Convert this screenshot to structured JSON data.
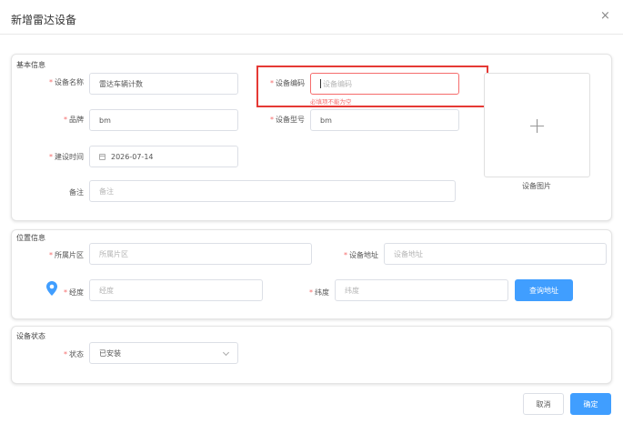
{
  "dialog": {
    "title": "新增雷达设备",
    "close_icon": "×"
  },
  "basic": {
    "title": "基本信息",
    "name_label": "设备名称",
    "name_value": "雷达车辆计数",
    "code_label": "设备编码",
    "code_placeholder": "设备编码",
    "code_error": "必填项不能为空",
    "brand_label": "品牌",
    "brand_value": "bm",
    "model_label": "设备型号",
    "model_value": "bm",
    "date_label": "建设时间",
    "date_value": "2026-07-14",
    "remark_label": "备注",
    "remark_placeholder": "备注",
    "image_label": "设备图片",
    "plus": "+"
  },
  "location": {
    "title": "位置信息",
    "area_label": "所属片区",
    "area_placeholder": "所属片区",
    "address_label": "设备地址",
    "address_placeholder": "设备地址",
    "lng_label": "经度",
    "lng_placeholder": "经度",
    "lat_label": "纬度",
    "lat_placeholder": "纬度",
    "query_button": "查询地址"
  },
  "status": {
    "title": "设备状态",
    "status_label": "状态",
    "status_value": "已安装"
  },
  "footer": {
    "cancel": "取消",
    "confirm": "确定"
  },
  "colors": {
    "primary": "#409eff",
    "error": "#f56c6c",
    "highlight": "#e53935"
  }
}
